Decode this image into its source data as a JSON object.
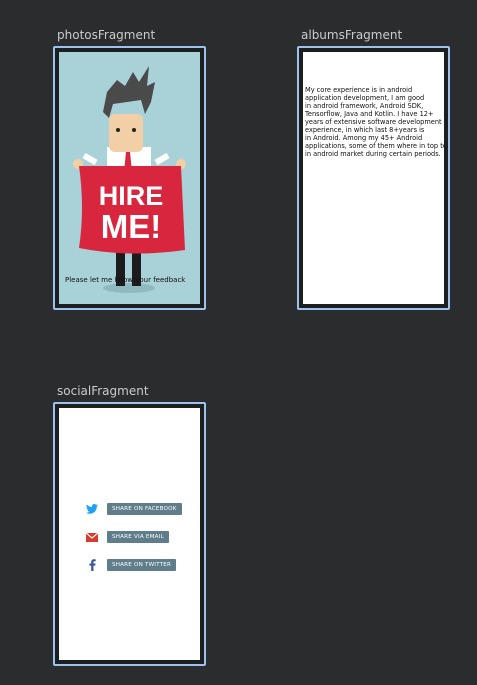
{
  "fragments": {
    "photos": {
      "title": "photosFragment",
      "feedback_text": "Please let me know your feedback",
      "sign_text_line1": "HIRE",
      "sign_text_line2": "ME!"
    },
    "albums": {
      "title": "albumsFragment",
      "body_text": "My core experience is in android\napplication development, I am good\nin android framework, Android SDK,\nTensorflow, Java and Kotlin. I have 12+\nyears of extensive software development\nexperience, in which last 8+years is\nin Android. Among my 45+ Android\napplications, some of them where in top ten\nin android market during certain periods."
    },
    "social": {
      "title": "socialFragment",
      "buttons": [
        {
          "label": "SHARE ON FACEBOOK",
          "icon": "twitter-icon"
        },
        {
          "label": "SHARE VIA EMAIL",
          "icon": "email-icon"
        },
        {
          "label": "SHARE ON TWITTER",
          "icon": "facebook-icon"
        }
      ]
    }
  },
  "colors": {
    "background": "#2b2c2e",
    "frame_border": "#9cc3ee",
    "button": "#607d8b",
    "twitter": "#1da1f2",
    "email": "#d93a2b",
    "facebook": "#3b5998",
    "banner": "#d7263d"
  }
}
